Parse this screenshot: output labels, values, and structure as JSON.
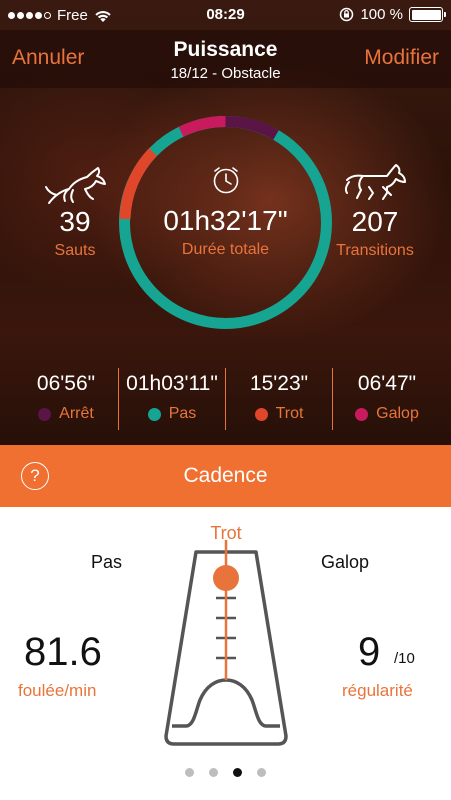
{
  "status_bar": {
    "carrier": "Free",
    "time": "08:29",
    "battery": "100 %"
  },
  "nav": {
    "cancel": "Annuler",
    "title": "Puissance",
    "subtitle": "18/12  - Obstacle",
    "edit": "Modifier"
  },
  "summary": {
    "jumps_value": "39",
    "jumps_label": "Sauts",
    "duration_value": "01h32'17\"",
    "duration_label": "Durée totale",
    "transitions_value": "207",
    "transitions_label": "Transitions"
  },
  "gaits": [
    {
      "time": "06'56\"",
      "label": "Arrêt",
      "color": "#5a1446"
    },
    {
      "time": "01h03'11\"",
      "label": "Pas",
      "color": "#16a592"
    },
    {
      "time": "15'23\"",
      "label": "Trot",
      "color": "#e0462a"
    },
    {
      "time": "06'47\"",
      "label": "Galop",
      "color": "#c81a5c"
    }
  ],
  "cadence": {
    "title": "Cadence",
    "help": "?",
    "left_label": "Pas",
    "right_label": "Galop",
    "current_gait": "Trot",
    "stride_value": "81.6",
    "stride_unit": "foulée/min",
    "regularity_value": "9",
    "regularity_scale": "/10",
    "regularity_label": "régularité"
  },
  "pager": {
    "pages": 4,
    "active_index": 2
  },
  "colors": {
    "accent": "#e8743b",
    "bar": "#f07032"
  }
}
